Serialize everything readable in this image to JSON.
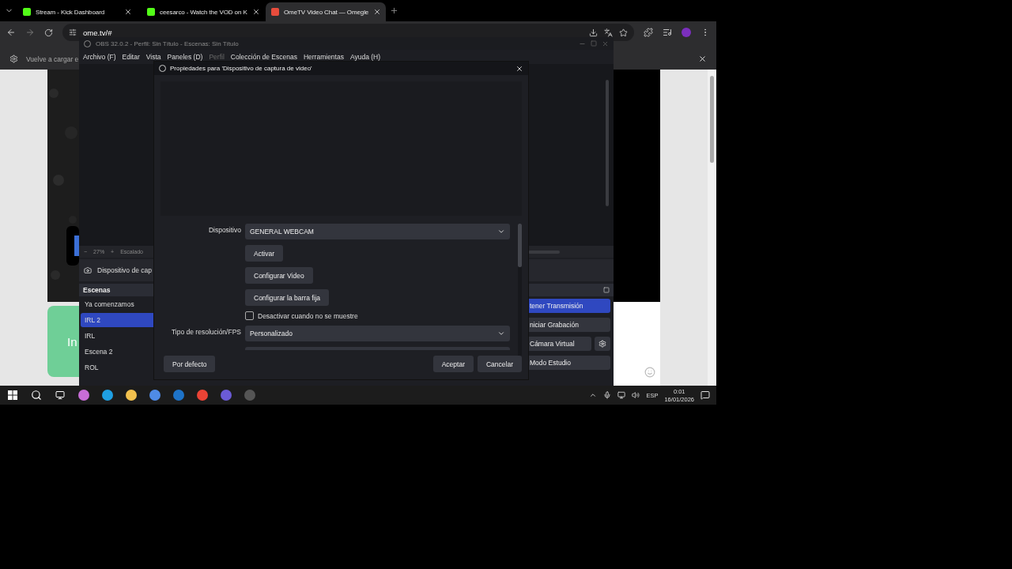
{
  "browser": {
    "tabs": [
      {
        "title": "Stream - Kick Dashboard",
        "selected": false,
        "kind": "kick"
      },
      {
        "title": "ceesarco - Watch the VOD on K",
        "selected": false,
        "kind": "kick"
      },
      {
        "title": "OmeTV Video Chat — Omegle",
        "selected": true,
        "kind": "ome"
      }
    ],
    "address": "ome.tv/#",
    "infobar": "Vuelve a cargar e"
  },
  "page": {
    "start_button": "In"
  },
  "obs": {
    "title": "OBS 32.0.2 - Perfil: Sin Título - Escenas: Sin Título",
    "menu": [
      {
        "label": "Archivo (F)",
        "disabled": false
      },
      {
        "label": "Editar",
        "disabled": false
      },
      {
        "label": "Vista",
        "disabled": false
      },
      {
        "label": "Paneles (D)",
        "disabled": false
      },
      {
        "label": "Perfil",
        "disabled": true
      },
      {
        "label": "Colección de Escenas",
        "disabled": false
      },
      {
        "label": "Herramientas",
        "disabled": false
      },
      {
        "label": "Ayuda (H)",
        "disabled": false
      }
    ],
    "zoom": {
      "minus": "−",
      "value": "27%",
      "plus": "+",
      "mode": "Escalado"
    },
    "source": "Dispositivo de cap",
    "scenes_title": "Escenas",
    "scenes": [
      {
        "name": "Ya comenzamos",
        "selected": false
      },
      {
        "name": "IRL 2",
        "selected": true
      },
      {
        "name": "IRL",
        "selected": false
      },
      {
        "name": "Escena 2",
        "selected": false
      },
      {
        "name": "ROL",
        "selected": false
      }
    ],
    "controls": [
      {
        "label": "tener Transmisión",
        "kind": "active"
      },
      {
        "label": "niciar Grabación",
        "kind": "plain"
      },
      {
        "label": "Cámara Virtual",
        "kind": "settings"
      },
      {
        "label": "Modo Estudio",
        "kind": "plain"
      }
    ]
  },
  "dialog": {
    "title": "Propiedades para 'Dispositivo de captura de video'",
    "fields": [
      {
        "kind": "select",
        "label": "Dispositivo",
        "value": "GENERAL WEBCAM"
      },
      {
        "kind": "button",
        "label": "Activar"
      },
      {
        "kind": "button",
        "label": "Configurar Video"
      },
      {
        "kind": "button",
        "label": "Configurar la barra fija"
      },
      {
        "kind": "checkbox",
        "label": "Desactivar cuando no se muestre",
        "checked": false
      },
      {
        "kind": "select",
        "label": "Tipo de resolución/FPS",
        "value": "Personalizado"
      }
    ],
    "left_buttons": [
      "Por defecto"
    ],
    "right_buttons": [
      "Aceptar",
      "Cancelar"
    ]
  },
  "taskbar": {
    "language": "ESP",
    "time": "0:01",
    "date": "16/01/2026"
  }
}
